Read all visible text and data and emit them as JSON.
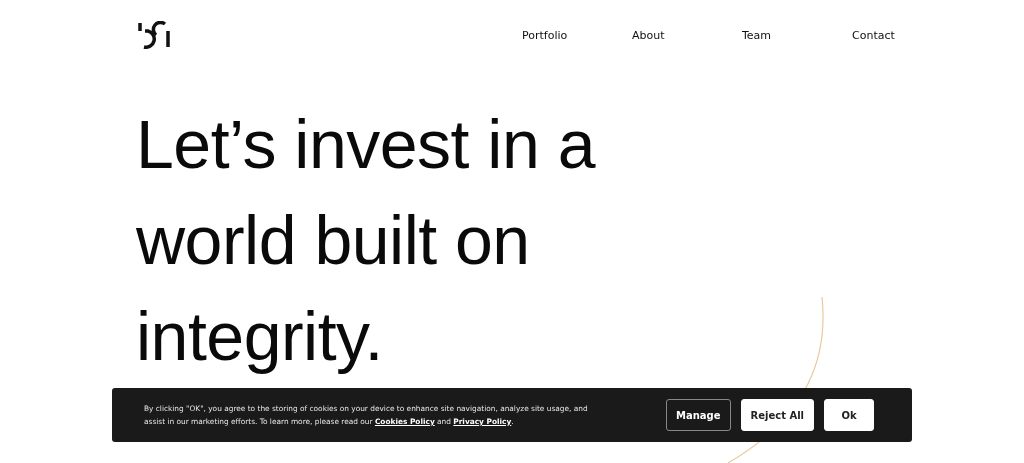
{
  "nav": {
    "items": [
      "Portfolio",
      "About",
      "Team",
      "Contact"
    ]
  },
  "hero": {
    "lines": [
      "Let’s invest in a",
      "world built on",
      "integrity."
    ]
  },
  "cookie_banner": {
    "text_before": "By clicking \"OK\", you agree to the storing of cookies on your device to enhance site navigation, analyze site usage, and assist in our marketing efforts. To learn more, please read our ",
    "links": [
      "Cookies Policy",
      "Privacy Policy"
    ],
    "joiner": " and ",
    "ending": ".",
    "buttons": [
      {
        "label": "Manage",
        "kind": "outline"
      },
      {
        "label": "Reject All",
        "kind": "filled"
      },
      {
        "label": "Ok",
        "kind": "filled"
      }
    ]
  }
}
